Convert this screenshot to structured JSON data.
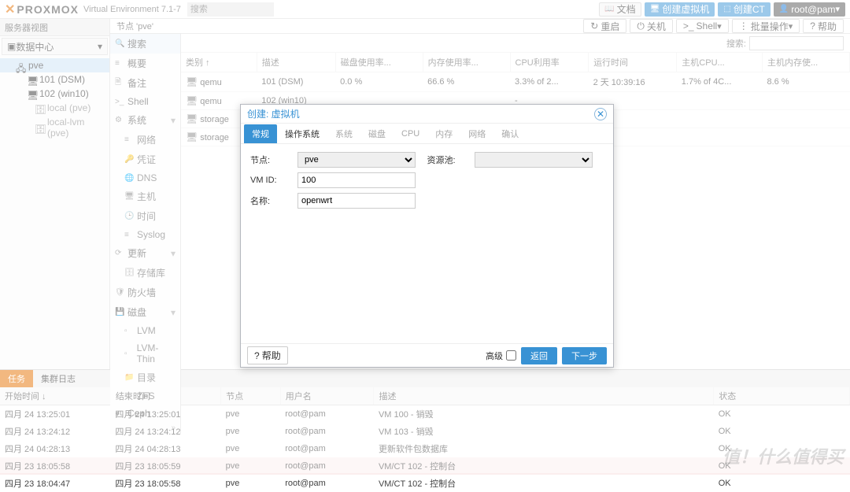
{
  "header": {
    "logo_text": "PROXMOX",
    "ve_text": "Virtual Environment 7.1-7",
    "search_placeholder": "搜索",
    "buttons": {
      "docs": "文档",
      "create_vm": "创建虚拟机",
      "create_ct": "创建CT",
      "user": "root@pam"
    }
  },
  "left_panel": {
    "title": "服务器视图",
    "view_selector": "数据中心",
    "tree": {
      "node": "pve",
      "children": [
        {
          "label": "101 (DSM)"
        },
        {
          "label": "102 (win10)"
        },
        {
          "label": "local (pve)"
        },
        {
          "label": "local-lvm (pve)"
        }
      ]
    }
  },
  "content": {
    "breadcrumb": "节点 'pve'",
    "toolbar": {
      "reboot": "重启",
      "shutdown": "关机",
      "shell": "Shell",
      "bulk": "批量操作",
      "help": "帮助"
    },
    "search_label": "搜索:",
    "sidemenu": [
      {
        "label": "搜索",
        "icon": "🔍",
        "active": true
      },
      {
        "label": "概要",
        "icon": "≡"
      },
      {
        "label": "备注",
        "icon": "🗎"
      },
      {
        "label": "Shell",
        "icon": ">_"
      },
      {
        "label": "系统",
        "icon": "⚙",
        "expand": true
      },
      {
        "label": "网络",
        "icon": "≡",
        "sub": true
      },
      {
        "label": "凭证",
        "icon": "🔑",
        "sub": true
      },
      {
        "label": "DNS",
        "icon": "🌐",
        "sub": true
      },
      {
        "label": "主机",
        "icon": "🖥",
        "sub": true
      },
      {
        "label": "时间",
        "icon": "🕒",
        "sub": true
      },
      {
        "label": "Syslog",
        "icon": "≡",
        "sub": true
      },
      {
        "label": "更新",
        "icon": "⟳",
        "expand": true
      },
      {
        "label": "存储库",
        "icon": "🗄",
        "sub": true
      },
      {
        "label": "防火墙",
        "icon": "🛡"
      },
      {
        "label": "磁盘",
        "icon": "💾",
        "expand": true
      },
      {
        "label": "LVM",
        "icon": "▫",
        "sub": true
      },
      {
        "label": "LVM-Thin",
        "icon": "▫",
        "sub": true
      },
      {
        "label": "目录",
        "icon": "📁",
        "sub": true
      },
      {
        "label": "ZFS",
        "icon": "▫",
        "sub": true
      },
      {
        "label": "Ceph",
        "icon": "●"
      }
    ],
    "grid": {
      "columns": [
        "类别 ↑",
        "描述",
        "磁盘使用率...",
        "内存使用率...",
        "CPU利用率",
        "运行时间",
        "主机CPU...",
        "主机内存使..."
      ],
      "rows": [
        {
          "type": "qemu",
          "desc": "101 (DSM)",
          "disk": "0.0 %",
          "mem": "66.6 %",
          "cpu": "3.3% of 2...",
          "uptime": "2 天 10:39:16",
          "hcpu": "1.7% of 4C...",
          "hmem": "8.6 %"
        },
        {
          "type": "qemu",
          "desc": "102 (win10)",
          "disk": "",
          "mem": "",
          "cpu": "-",
          "uptime": "",
          "hcpu": "",
          "hmem": ""
        },
        {
          "type": "storage",
          "desc": "",
          "disk": "",
          "mem": "",
          "cpu": "",
          "uptime": "",
          "hcpu": "",
          "hmem": ""
        },
        {
          "type": "storage",
          "desc": "",
          "disk": "",
          "mem": "",
          "cpu": "",
          "uptime": "",
          "hcpu": "",
          "hmem": ""
        }
      ]
    }
  },
  "modal": {
    "title": "创建: 虚拟机",
    "tabs": [
      "常规",
      "操作系统",
      "系统",
      "磁盘",
      "CPU",
      "内存",
      "网络",
      "确认"
    ],
    "active_tab": 0,
    "fields": {
      "node_label": "节点:",
      "node_value": "pve",
      "vmid_label": "VM ID:",
      "vmid_value": "100",
      "name_label": "名称:",
      "name_value": "openwrt",
      "pool_label": "资源池:",
      "pool_value": ""
    },
    "footer": {
      "help": "帮助",
      "advanced": "高级",
      "back": "返回",
      "next": "下一步"
    }
  },
  "bottom": {
    "tabs": [
      "任务",
      "集群日志"
    ],
    "columns": [
      "开始时间 ↓",
      "结束时间",
      "节点",
      "用户名",
      "描述",
      "状态"
    ],
    "rows": [
      {
        "start": "四月 24 13:25:01",
        "end": "四月 24 13:25:01",
        "node": "pve",
        "user": "root@pam",
        "desc": "VM 100 - 销毁",
        "status": "OK"
      },
      {
        "start": "四月 24 13:24:12",
        "end": "四月 24 13:24:12",
        "node": "pve",
        "user": "root@pam",
        "desc": "VM 103 - 销毁",
        "status": "OK"
      },
      {
        "start": "四月 24 04:28:13",
        "end": "四月 24 04:28:13",
        "node": "pve",
        "user": "root@pam",
        "desc": "更新软件包数据库",
        "status": "OK"
      },
      {
        "start": "四月 23 18:05:58",
        "end": "四月 23 18:05:59",
        "node": "pve",
        "user": "root@pam",
        "desc": "VM/CT 102 - 控制台",
        "status": "OK",
        "hl": true
      },
      {
        "start": "四月 23 18:04:47",
        "end": "四月 23 18:05:58",
        "node": "pve",
        "user": "root@pam",
        "desc": "VM/CT 102 - 控制台",
        "status": "OK"
      }
    ]
  },
  "watermark": "值！什么值得买"
}
